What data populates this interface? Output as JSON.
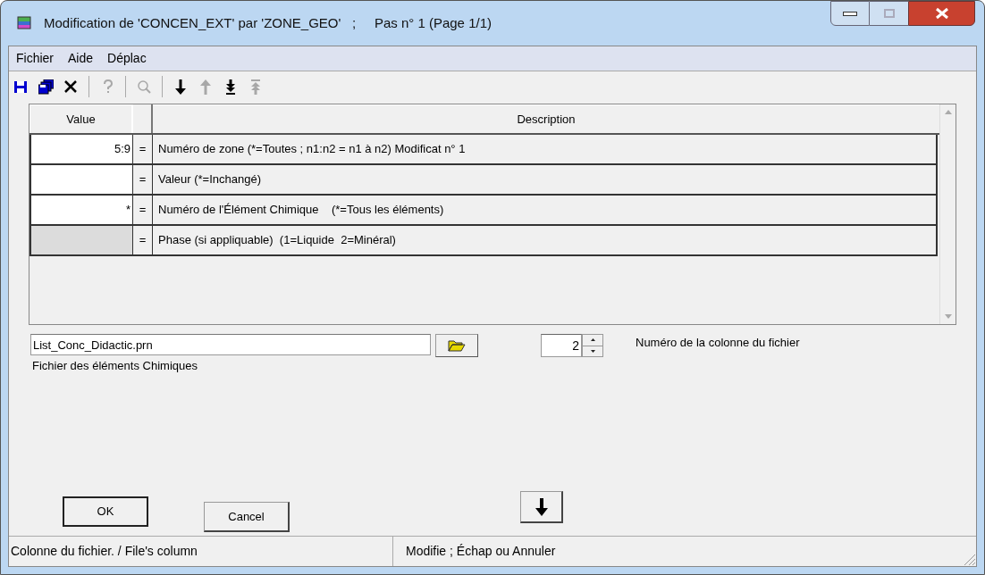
{
  "window": {
    "title": "Modification de 'CONCEN_EXT' par 'ZONE_GEO'   ;     Pas n° 1 (Page 1/1)"
  },
  "menu": [
    "Fichier",
    "Aide",
    "Déplac"
  ],
  "toolbar": [
    {
      "kind": "save",
      "disabled": false
    },
    {
      "kind": "save-all",
      "disabled": false
    },
    {
      "kind": "delete",
      "disabled": false
    },
    {
      "kind": "separator"
    },
    {
      "kind": "help",
      "disabled": true
    },
    {
      "kind": "separator"
    },
    {
      "kind": "zoom",
      "disabled": true
    },
    {
      "kind": "separator"
    },
    {
      "kind": "down",
      "disabled": false
    },
    {
      "kind": "up",
      "disabled": true
    },
    {
      "kind": "bottom",
      "disabled": false
    },
    {
      "kind": "top",
      "disabled": true
    }
  ],
  "grid": {
    "columns": [
      "Value",
      "Description"
    ],
    "rows": [
      {
        "value": "5:9",
        "sign": "=",
        "description": "Numéro de zone (*=Toutes ; n1:n2 = n1 à n2) Modificat n° 1",
        "disabled": false
      },
      {
        "value": "",
        "sign": "=",
        "description": "Valeur (*=Inchangé)",
        "disabled": false
      },
      {
        "value": "*",
        "sign": "=",
        "description": "Numéro de l'Élément Chimique    (*=Tous les éléments)",
        "disabled": false
      },
      {
        "value": "",
        "sign": "=",
        "description": "Phase (si appliquable)  (1=Liquide  2=Minéral)",
        "disabled": true
      }
    ]
  },
  "file": {
    "value": "List_Conc_Didactic.prn",
    "label": "Fichier des éléments Chimiques"
  },
  "column_spinner": {
    "value": "2",
    "label": "Numéro de la colonne du fichier"
  },
  "buttons": [
    "OK",
    "Cancel"
  ],
  "status_bar": [
    "Colonne du fichier. / File's column",
    "Modifie  ;  Échap ou Annuler"
  ]
}
